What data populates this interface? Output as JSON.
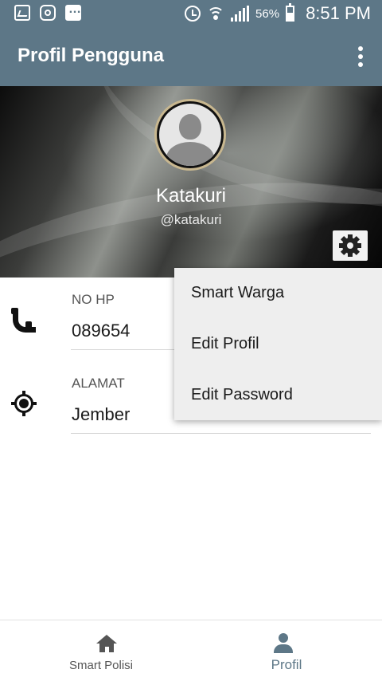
{
  "status_bar": {
    "battery": "56%",
    "time": "8:51 PM",
    "icons": [
      "gallery-icon",
      "instagram-icon",
      "message-icon",
      "alarm-icon",
      "wifi-icon",
      "signal-icon",
      "battery-icon"
    ]
  },
  "toolbar": {
    "title": "Profil Pengguna",
    "menu_icon": "more-vert-icon"
  },
  "profile": {
    "name": "Katakuri",
    "username": "@katakuri",
    "avatar_icon": "default-avatar-icon",
    "settings_icon": "gear-icon"
  },
  "info": {
    "phone_label": "NO HP",
    "phone_value": "089654",
    "address_label": "ALAMAT",
    "address_value": "Jember"
  },
  "popup_menu": {
    "items": [
      {
        "label": "Smart Warga"
      },
      {
        "label": "Edit Profil"
      },
      {
        "label": "Edit Password"
      }
    ]
  },
  "bottom_nav": {
    "items": [
      {
        "label": "Smart Polisi",
        "icon": "home-icon",
        "active": false
      },
      {
        "label": "Profil",
        "icon": "person-icon",
        "active": true
      }
    ]
  },
  "colors": {
    "primary": "#5d7787",
    "menu_bg": "#eeeeee",
    "inactive_nav": "#555555"
  }
}
